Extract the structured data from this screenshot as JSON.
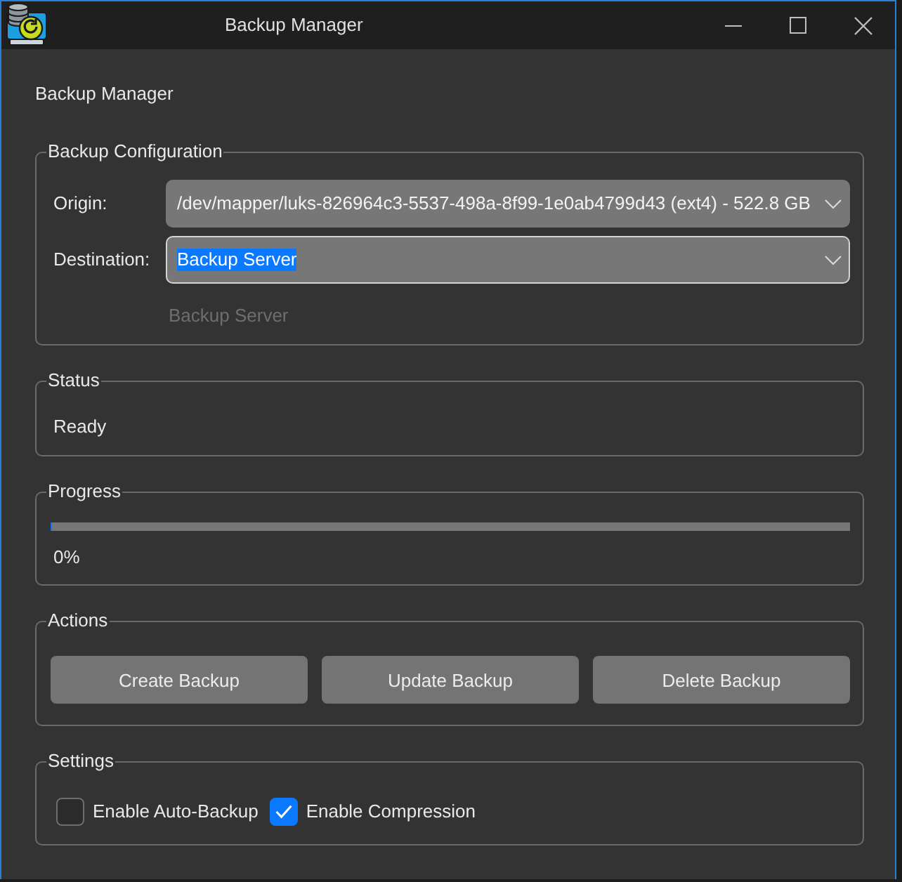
{
  "window": {
    "title": "Backup Manager"
  },
  "heading": "Backup Manager",
  "configuration": {
    "title": "Backup Configuration",
    "fields": [
      {
        "label": "Origin:",
        "value": "/dev/mapper/luks-826964c3-5537-498a-8f99-1e0ab4799d43 (ext4) - 522.8 GB",
        "focused": false
      },
      {
        "label": "Destination:",
        "value": "Backup Server",
        "focused": true
      }
    ],
    "hint": "Backup Server"
  },
  "status": {
    "title": "Status",
    "text": "Ready"
  },
  "progress": {
    "title": "Progress",
    "level": 0,
    "reading": "0%"
  },
  "actions": {
    "title": "Actions",
    "buttons": [
      {
        "label": "Create Backup"
      },
      {
        "label": "Update Backup"
      },
      {
        "label": "Delete Backup"
      }
    ]
  },
  "settings": {
    "title": "Settings",
    "options": [
      {
        "label": "Enable Auto-Backup",
        "checked": false
      },
      {
        "label": "Enable Compression",
        "checked": true
      }
    ]
  }
}
